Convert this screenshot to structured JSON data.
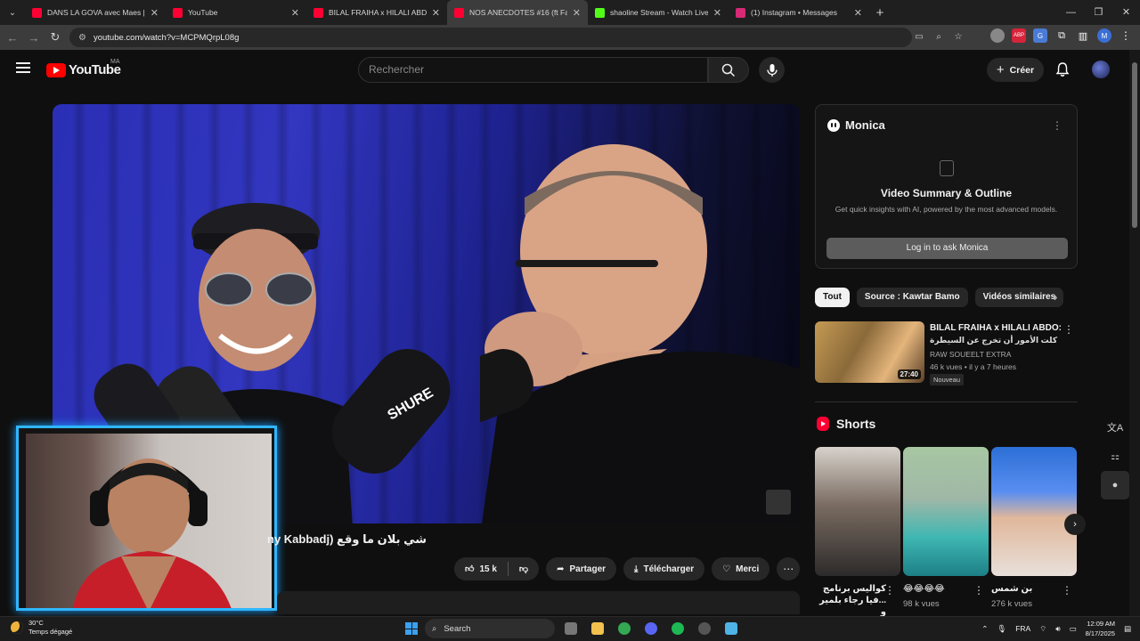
{
  "browser": {
    "tabs": [
      {
        "title": "DANS LA GOVA avec Maes | \"Le",
        "favicon_color": "#ff0033",
        "active": false
      },
      {
        "title": "YouTube",
        "favicon_color": "#ff0033",
        "active": false
      },
      {
        "title": "BILAL FRAIHA x HILALI ABDO:",
        "favicon_color": "#ff0033",
        "active": false
      },
      {
        "title": "NOS ANECDOTES #16 (ft Fa",
        "favicon_color": "#ff0033",
        "active": true
      },
      {
        "title": "shaoline Stream - Watch Live o",
        "favicon_color": "#53fc18",
        "active": false
      },
      {
        "title": "(1) Instagram • Messages",
        "favicon_color": "#d62976",
        "active": false
      }
    ],
    "url": "youtube.com/watch?v=MCPMQrpL08g"
  },
  "youtube": {
    "logo_text": "YouTube",
    "country_code": "MA",
    "search_placeholder": "Rechercher",
    "create_label": "Créer"
  },
  "video": {
    "title": "شي بلان ما وقع (ny Kabbadj",
    "likes": "15 k",
    "share_label": "Partager",
    "download_label": "Télécharger",
    "thanks_label": "Merci"
  },
  "monica": {
    "name": "Monica",
    "heading": "Video Summary & Outline",
    "subtitle": "Get quick insights with AI, powered by the most advanced models.",
    "login_label": "Log in to ask Monica"
  },
  "chips": [
    "Tout",
    "Source : Kawtar Bamo",
    "Vidéos similaires"
  ],
  "related": {
    "title": "BILAL FRAIHA x HILALI ABDO:",
    "title_ar": "كلت الأمور أن تخرج عن السيطرة",
    "channel": "RAW SOUEELT EXTRA",
    "stats": "46 k vues • il y a 7 heures",
    "badge": "Nouveau",
    "duration": "27:40"
  },
  "shorts": {
    "heading": "Shorts",
    "items": [
      {
        "title": "كواليس برنامج ...فيا رجاء بلمير و",
        "views": ""
      },
      {
        "title": "😂😂😂😂",
        "views": "98 k vues"
      },
      {
        "title": "بن شمس",
        "views": "276 k vues"
      }
    ]
  },
  "taskbar": {
    "temperature": "30°C",
    "weather": "Temps dégagé",
    "search_label": "Search",
    "language": "FRA",
    "time": "12:09 AM",
    "date": "8/17/2025"
  }
}
